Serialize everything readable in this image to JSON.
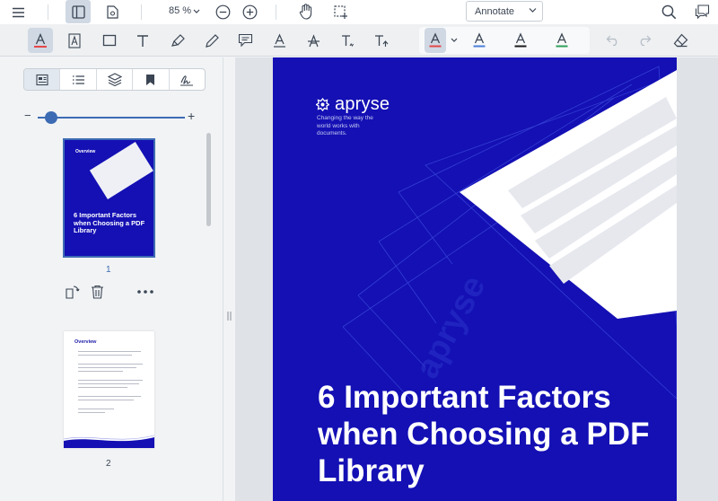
{
  "header": {
    "zoom_value": "85 %",
    "mode_select": "Annotate",
    "icons": [
      "menu-icon",
      "panel-toggle-icon",
      "file-settings-icon",
      "zoom-out-icon",
      "zoom-in-icon",
      "pan-icon",
      "selection-icon",
      "search-icon",
      "comments-icon"
    ]
  },
  "toolbar": {
    "tools": [
      "text-highlight-icon",
      "free-text-icon",
      "rectangle-icon",
      "text-icon",
      "highlighter-icon",
      "pen-icon",
      "comment-icon",
      "text-underline-icon",
      "strikeout-icon",
      "squiggly-icon",
      "insert-text-icon"
    ],
    "style_presets": [
      "style-preset-red",
      "style-preset-blue",
      "style-preset-black",
      "style-preset-green"
    ],
    "actions": [
      "undo-icon",
      "redo-icon",
      "eraser-icon"
    ],
    "colors": {
      "red": "#e44848",
      "blue": "#4a7fd6",
      "black": "#1a1a1a",
      "green": "#2ea05a"
    }
  },
  "left_panel": {
    "tabs": [
      "thumbnails-icon",
      "outline-icon",
      "layers-icon",
      "bookmarks-icon",
      "signatures-icon"
    ],
    "thumbnail_size": 0.05,
    "thumbnails": [
      {
        "page_num": "1",
        "selected": true,
        "overview": "Overview",
        "title": "6 Important Factors when Choosing a PDF Library"
      },
      {
        "page_num": "2",
        "selected": false,
        "overview": "Overview"
      }
    ]
  },
  "document": {
    "logo_text": "apryse",
    "tagline": "Changing the way the world works with documents.",
    "title": "6 Important Factors when Choosing a PDF Library",
    "watermark": "apryse",
    "colors": {
      "page_bg": "#1410b4",
      "accent": "#3d6bb3"
    }
  }
}
